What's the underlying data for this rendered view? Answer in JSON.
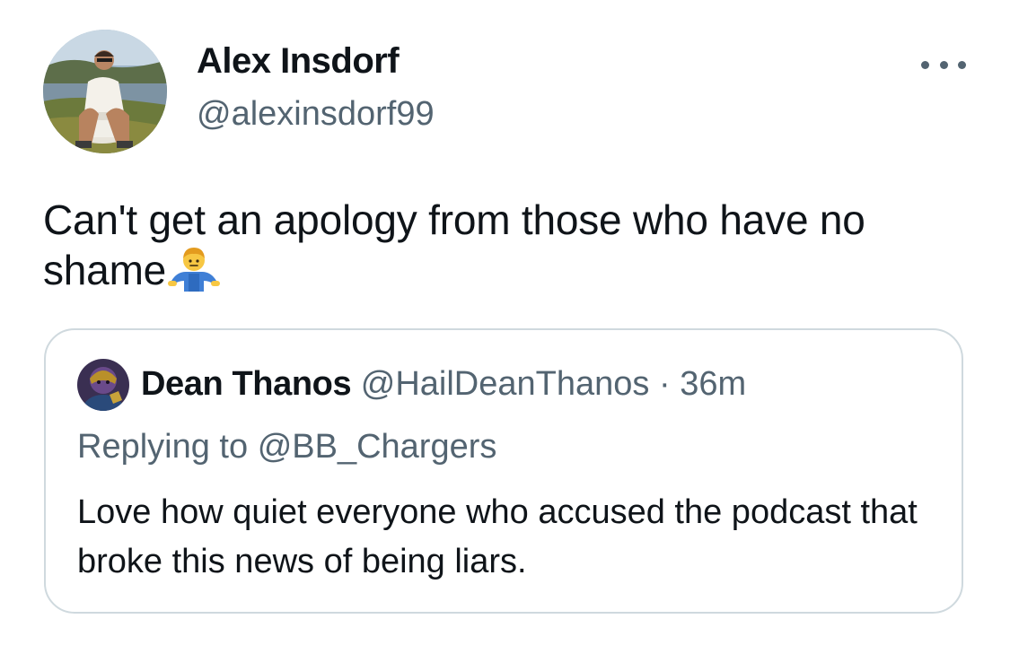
{
  "author": {
    "display_name": "Alex Insdorf",
    "handle": "@alexinsdorf99",
    "avatar_icon": "profile-photo"
  },
  "more_icon": "more-horizontal-icon",
  "tweet": {
    "text": "Can't get an apology from those who have no shame",
    "emoji": "person-shrugging-emoji"
  },
  "quoted_tweet": {
    "display_name": "Dean Thanos",
    "handle": "@HailDeanThanos",
    "separator": "·",
    "time": "36m",
    "replying_prefix": "Replying to",
    "replying_to": "@BB_Chargers",
    "text": "Love how quiet everyone who accused the podcast that broke this news of being liars."
  },
  "colors": {
    "primary_text": "#0f1419",
    "secondary_text": "#536471",
    "border": "#cfd9de",
    "background": "#ffffff"
  }
}
